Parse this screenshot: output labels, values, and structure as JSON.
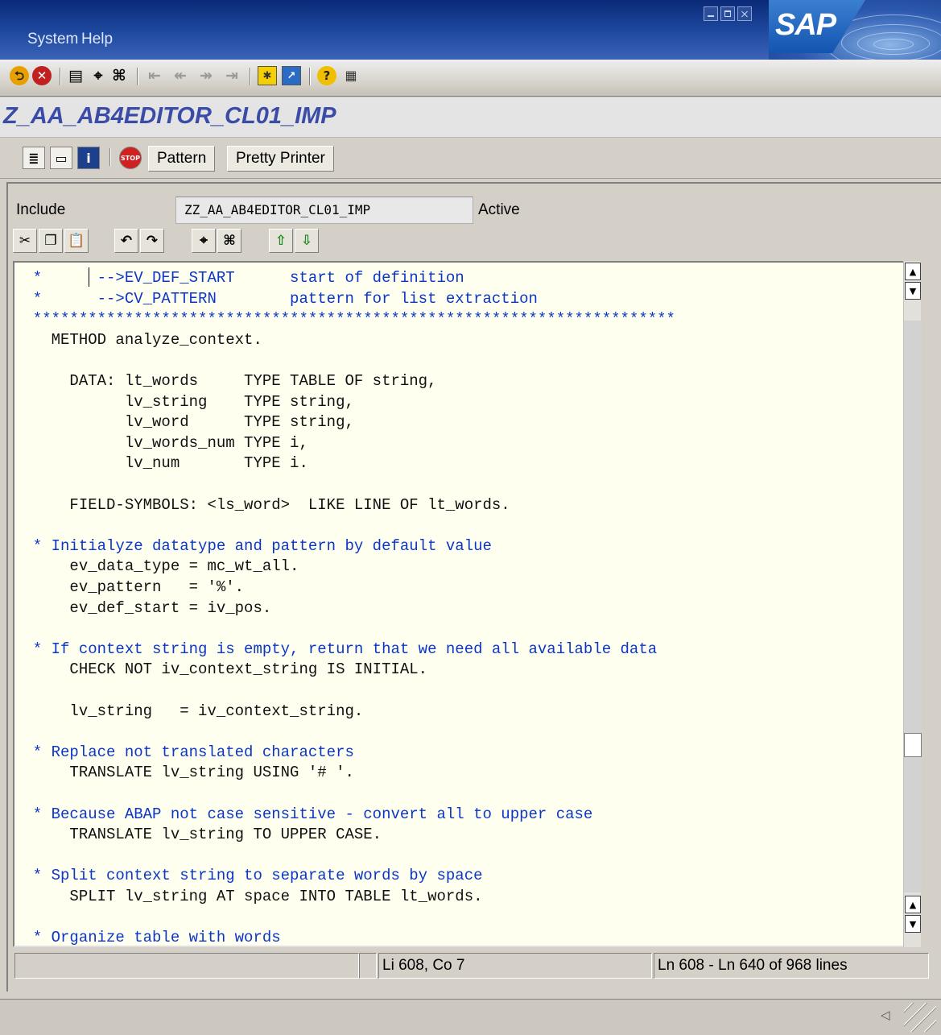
{
  "menu": {
    "items": [
      {
        "label": "System"
      },
      {
        "label": "Help"
      }
    ]
  },
  "brand": {
    "logo_text": "SAP",
    "accent": "#0a2a78"
  },
  "std_toolbar": {
    "icons": [
      "back-icon",
      "cancel-icon",
      "print-icon",
      "find-icon",
      "find-next-icon",
      "first-page-icon",
      "previous-page-icon",
      "next-page-icon",
      "last-page-icon",
      "create-session-icon",
      "shortcut-icon",
      "help-icon",
      "layout-menu-icon"
    ]
  },
  "title": {
    "text": "Z_AA_AB4EDITOR_CL01_IMP"
  },
  "app_toolbar": {
    "pattern_label": "Pattern",
    "pretty_printer_label": "Pretty Printer"
  },
  "include": {
    "label": "Include",
    "value": "ZZ_AA_AB4EDITOR_CL01_IMP",
    "status": "Active"
  },
  "editor_toolbar": {
    "icons": [
      "cut-icon",
      "copy-icon",
      "paste-icon",
      "undo-icon",
      "redo-icon",
      "find-icon",
      "find-next-icon",
      "upload-icon",
      "download-icon"
    ]
  },
  "code": {
    "lines": [
      {
        "text": "  *      -->EV_DEF_START      start of definition",
        "comment": true
      },
      {
        "text": "  *      -->CV_PATTERN        pattern for list extraction",
        "comment": true
      },
      {
        "text": "  **********************************************************************",
        "comment": true
      },
      {
        "text": "    METHOD analyze_context.",
        "comment": false
      },
      {
        "text": "",
        "comment": false
      },
      {
        "text": "      DATA: lt_words     TYPE TABLE OF string,",
        "comment": false
      },
      {
        "text": "            lv_string    TYPE string,",
        "comment": false
      },
      {
        "text": "            lv_word      TYPE string,",
        "comment": false
      },
      {
        "text": "            lv_words_num TYPE i,",
        "comment": false
      },
      {
        "text": "            lv_num       TYPE i.",
        "comment": false
      },
      {
        "text": "",
        "comment": false
      },
      {
        "text": "      FIELD-SYMBOLS: <ls_word>  LIKE LINE OF lt_words.",
        "comment": false
      },
      {
        "text": "",
        "comment": false
      },
      {
        "text": "  * Initialyze datatype and pattern by default value",
        "comment": true
      },
      {
        "text": "      ev_data_type = mc_wt_all.",
        "comment": false
      },
      {
        "text": "      ev_pattern   = '%'.",
        "comment": false
      },
      {
        "text": "      ev_def_start = iv_pos.",
        "comment": false
      },
      {
        "text": "",
        "comment": false
      },
      {
        "text": "  * If context string is empty, return that we need all available data",
        "comment": true
      },
      {
        "text": "      CHECK NOT iv_context_string IS INITIAL.",
        "comment": false
      },
      {
        "text": "",
        "comment": false
      },
      {
        "text": "      lv_string   = iv_context_string.",
        "comment": false
      },
      {
        "text": "",
        "comment": false
      },
      {
        "text": "  * Replace not translated characters",
        "comment": true
      },
      {
        "text": "      TRANSLATE lv_string USING '# '.",
        "comment": false
      },
      {
        "text": "",
        "comment": false
      },
      {
        "text": "  * Because ABAP not case sensitive - convert all to upper case",
        "comment": true
      },
      {
        "text": "      TRANSLATE lv_string TO UPPER CASE.",
        "comment": false
      },
      {
        "text": "",
        "comment": false
      },
      {
        "text": "  * Split context string to separate words by space",
        "comment": true
      },
      {
        "text": "      SPLIT lv_string AT space INTO TABLE lt_words.",
        "comment": false
      },
      {
        "text": "",
        "comment": false
      },
      {
        "text": "  * Organize table with words",
        "comment": true
      }
    ]
  },
  "editor_status": {
    "position": "Li 608, Co 7",
    "range": "Ln 608 - Ln 640 of 968 lines"
  },
  "colors": {
    "comment": "#0b36c6",
    "editor_bg": "#fffff0",
    "title": "#3a4ca8"
  }
}
